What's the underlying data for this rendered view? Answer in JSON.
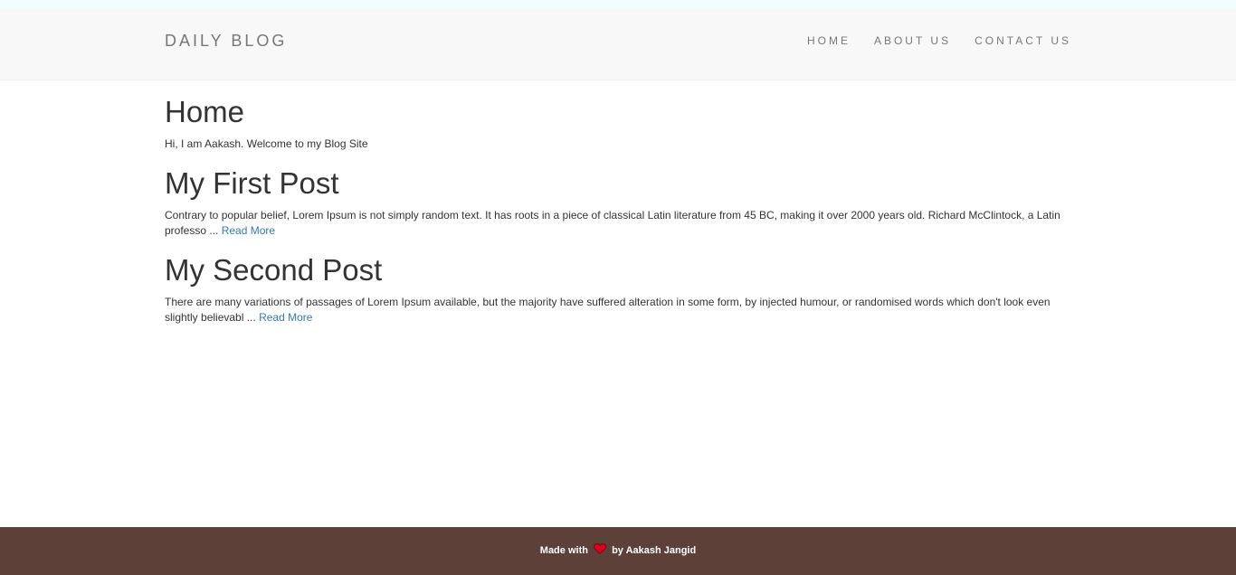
{
  "navbar": {
    "brand": "DAILY BLOG",
    "links": [
      "HOME",
      "ABOUT US",
      "CONTACT US"
    ]
  },
  "home": {
    "title": "Home",
    "intro": "Hi, I am Aakash. Welcome to my Blog Site"
  },
  "posts": [
    {
      "title": "My First Post",
      "excerpt": "Contrary to popular belief, Lorem Ipsum is not simply random text. It has roots in a piece of classical Latin literature from 45 BC, making it over 2000 years old. Richard McClintock, a Latin professo ...",
      "read_more": "Read More"
    },
    {
      "title": "My Second Post",
      "excerpt": "There are many variations of passages of Lorem Ipsum available, but the majority have suffered alteration in some form, by injected humour, or randomised words which don't look even slightly believabl ...",
      "read_more": "Read More"
    }
  ],
  "footer": {
    "made_with": "Made with",
    "heart_icon": "heart-icon",
    "by": "by Aakash Jangid"
  },
  "colors": {
    "navbar_bg": "#f8f8f8",
    "footer_bg": "#5d4037",
    "link": "#337ab7",
    "heart": "#e0001b"
  }
}
